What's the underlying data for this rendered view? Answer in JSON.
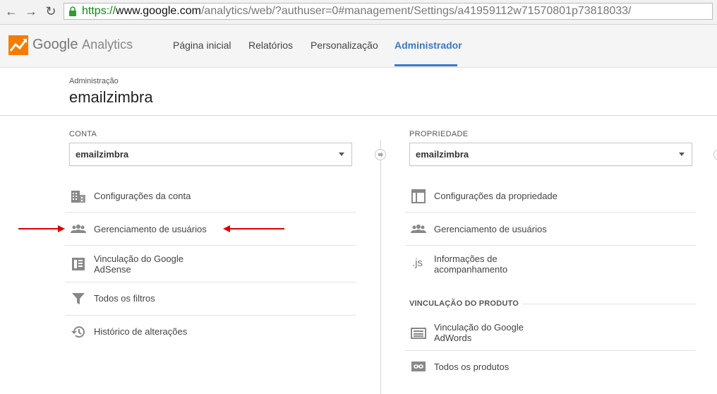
{
  "browser": {
    "url_scheme": "https://",
    "url_host": "www.google.com",
    "url_path": "/analytics/web/?authuser=0#management/Settings/a41959112w71570801p73818033/"
  },
  "app": {
    "logo_google": "Google",
    "logo_product": "Analytics"
  },
  "nav": {
    "tabs": [
      {
        "label": "Página inicial"
      },
      {
        "label": "Relatórios"
      },
      {
        "label": "Personalização"
      },
      {
        "label": "Administrador",
        "active": true
      }
    ]
  },
  "page": {
    "breadcrumb": "Administração",
    "title": "emailzimbra"
  },
  "account": {
    "heading": "CONTA",
    "selected": "emailzimbra",
    "items": [
      {
        "label": "Configurações da conta",
        "icon": "building-icon"
      },
      {
        "label": "Gerenciamento de usuários",
        "icon": "users-icon"
      },
      {
        "label": "Vinculação do Google AdSense",
        "line1": "Vinculação do Google",
        "line2": "AdSense",
        "icon": "adsense-icon"
      },
      {
        "label": "Todos os filtros",
        "icon": "filter-icon"
      },
      {
        "label": "Histórico de alterações",
        "icon": "history-icon"
      }
    ]
  },
  "property": {
    "heading": "PROPRIEDADE",
    "selected": "emailzimbra",
    "items": [
      {
        "label": "Configurações da propriedade",
        "icon": "layout-icon"
      },
      {
        "label": "Gerenciamento de usuários",
        "icon": "users-icon"
      },
      {
        "label": "Informações de acompanhamento",
        "line1": "Informações de",
        "line2": "acompanhamento",
        "icon": "js-icon",
        "icon_text": ".js"
      }
    ],
    "product_heading": "VINCULAÇÃO DO PRODUTO",
    "product_items": [
      {
        "label": "Vinculação do Google AdWords",
        "line1": "Vinculação do Google",
        "line2": "AdWords",
        "icon": "adwords-icon"
      },
      {
        "label": "Todos os produtos",
        "icon": "link-icon"
      }
    ]
  },
  "colors": {
    "accent": "#3b78c8",
    "annotation_arrow": "#e00000",
    "url_scheme": "#0a8a0a"
  }
}
